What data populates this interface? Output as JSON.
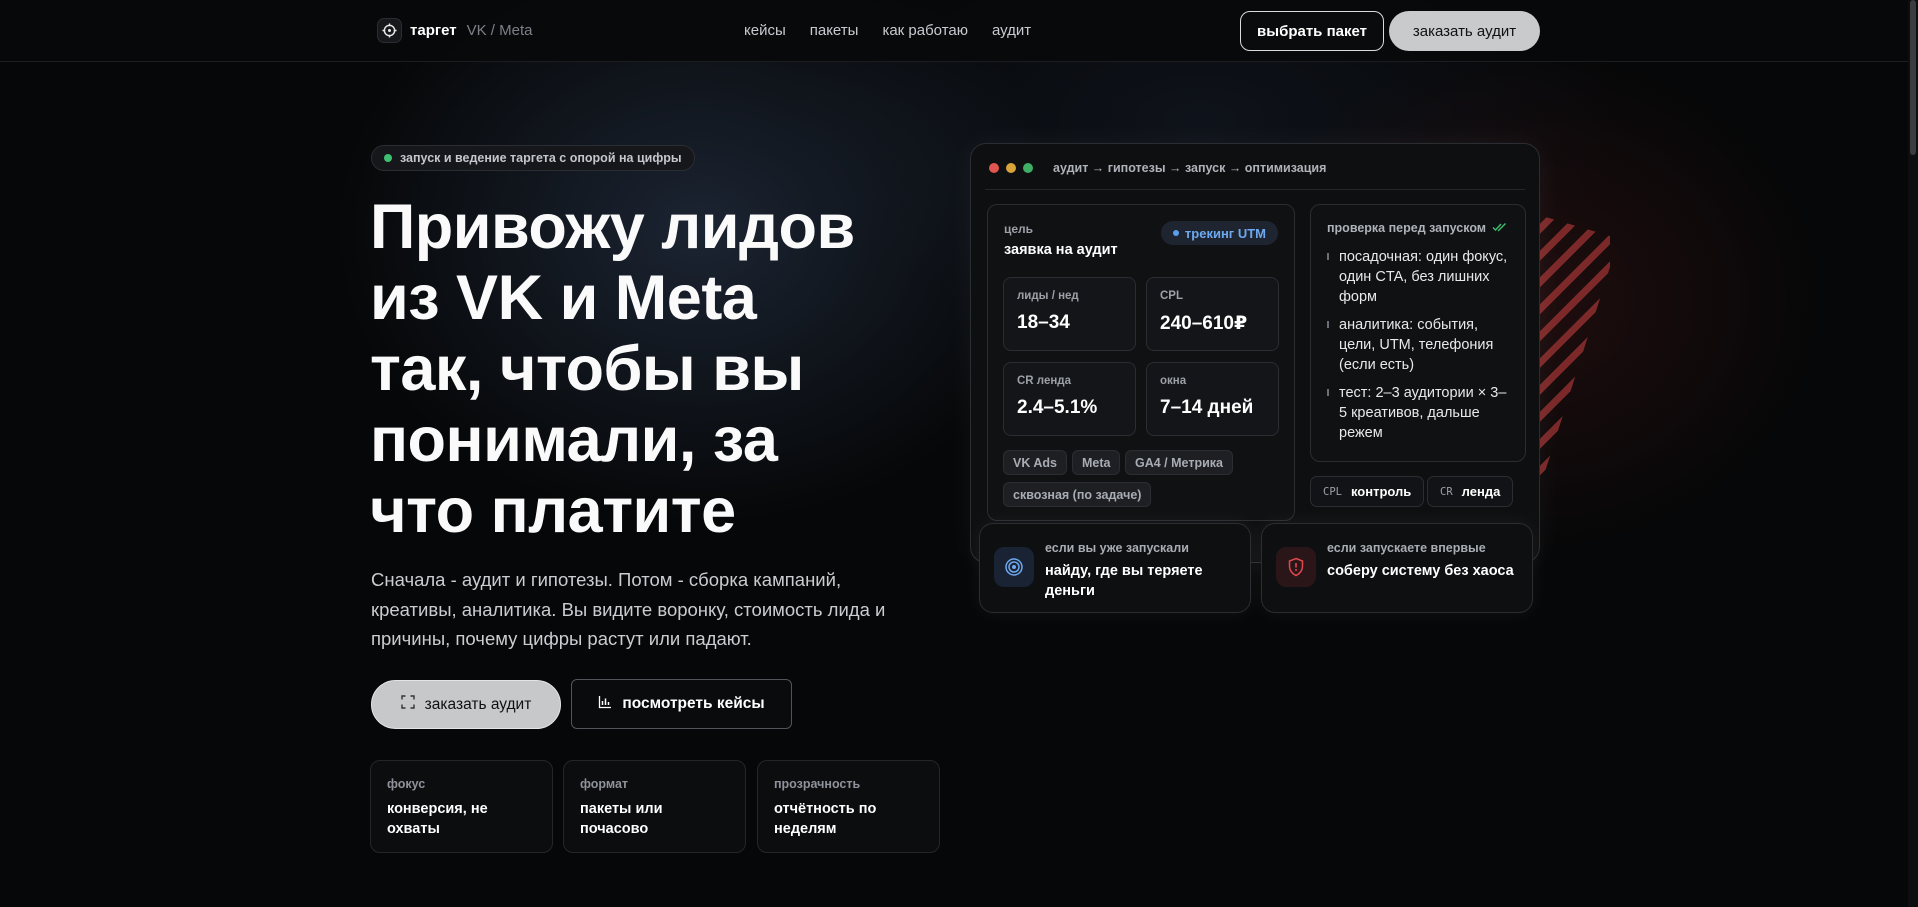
{
  "header": {
    "brand_name": "таргет",
    "brand_sub": "VK / Meta",
    "nav": [
      "кейсы",
      "пакеты",
      "как работаю",
      "аудит"
    ],
    "btn_choose": "выбрать пакет",
    "btn_order": "заказать аудит"
  },
  "hero": {
    "pill": "запуск и ведение таргета с опорой на цифры",
    "title_lines": [
      "Привожу лидов",
      "из VK и Meta",
      "так, чтобы вы",
      "понимали, за",
      "что платите"
    ],
    "lead": "Сначала - аудит и гипотезы. Потом - сборка кампаний, креативы, аналитика. Вы видите воронку, стоимость лида и причины, почему цифры растут или падают.",
    "cta_primary": "заказать аудит",
    "cta_secondary": "посмотреть кейсы",
    "features": [
      {
        "k": "фокус",
        "v": "конверсия, не охваты"
      },
      {
        "k": "формат",
        "v": "пакеты или почасово"
      },
      {
        "k": "прозрачность",
        "v": "отчётность по неделям"
      }
    ]
  },
  "dashboard": {
    "title": "аудит → гипотезы → запуск → оптимизация",
    "goal_label": "цель",
    "goal_value": "заявка на аудит",
    "utm_badge": "трекинг UTM",
    "metrics": [
      {
        "k": "лиды / нед",
        "v": "18–34"
      },
      {
        "k": "CPL",
        "v": "240–610₽"
      },
      {
        "k": "CR ленда",
        "v": "2.4–5.1%"
      },
      {
        "k": "окна",
        "v": "7–14 дней"
      }
    ],
    "chips": [
      "VK Ads",
      "Meta",
      "GA4 / Метрика",
      "сквозная (по задаче)"
    ],
    "check_title": "проверка перед запуском",
    "check_items": [
      "посадочная: один фокус, один CTA, без лишних форм",
      "аналитика: события, цели, UTM, телефония (если есть)",
      "тест: 2–3 аудитории × 3–5 креативов, дальше режем"
    ],
    "tags": [
      {
        "k": "CPL",
        "v": "контроль"
      },
      {
        "k": "CR",
        "v": "ленда"
      }
    ]
  },
  "cards": [
    {
      "k": "если вы уже запускали",
      "v": "найду, где вы теряете деньги",
      "icon": "target-icon"
    },
    {
      "k": "если запускаете впервые",
      "v": "соберу систему без хаоса",
      "icon": "shield-icon"
    }
  ],
  "colors": {
    "accent_green": "#3fbf72",
    "accent_blue": "#6ea8ef",
    "accent_red": "#e0484f",
    "traffic_red": "#e0554f",
    "traffic_yellow": "#d8a43a",
    "traffic_green": "#3fae66"
  }
}
